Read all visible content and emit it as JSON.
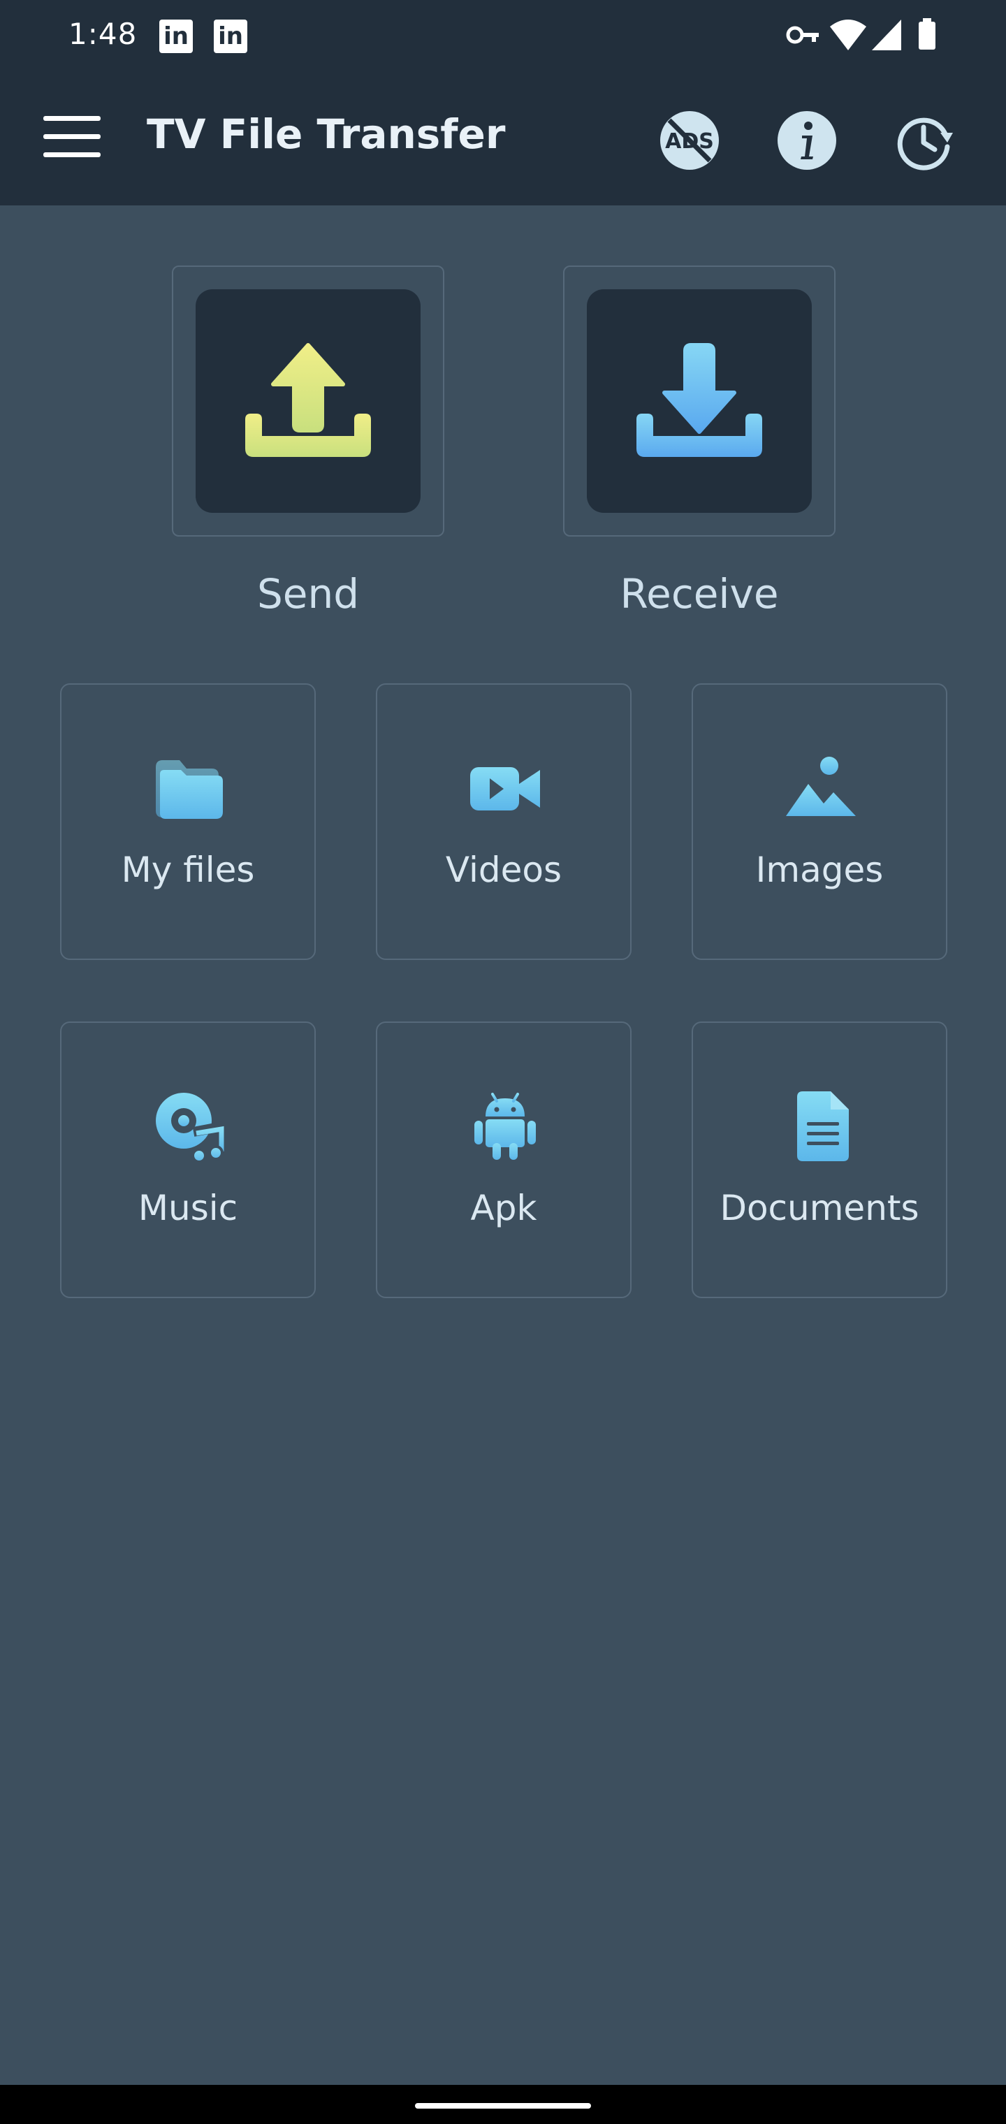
{
  "status_bar": {
    "time": "1:48",
    "notification_icons": [
      "linkedin-icon",
      "linkedin-icon"
    ],
    "system_icons": [
      "vpn-key-icon",
      "wifi-icon",
      "signal-icon",
      "battery-icon"
    ]
  },
  "app_bar": {
    "title": "TV File Transfer",
    "actions": [
      "remove-ads-icon",
      "info-icon",
      "history-icon"
    ],
    "remove_ads_label": "ADS"
  },
  "hero": {
    "send_label": "Send",
    "receive_label": "Receive"
  },
  "categories": [
    {
      "label": "My files",
      "icon": "folder-icon"
    },
    {
      "label": "Videos",
      "icon": "video-camera-icon"
    },
    {
      "label": "Images",
      "icon": "image-icon"
    },
    {
      "label": "Music",
      "icon": "music-icon"
    },
    {
      "label": "Apk",
      "icon": "android-icon"
    },
    {
      "label": "Documents",
      "icon": "document-icon"
    }
  ],
  "colors": {
    "background": "#3d4f5e",
    "bar": "#222f3c",
    "accent_send": "#d8e88a",
    "accent_receive": "#6fc3ef",
    "icon_gradient_top": "#7fdcf4",
    "icon_gradient_bottom": "#5bb8ea"
  }
}
